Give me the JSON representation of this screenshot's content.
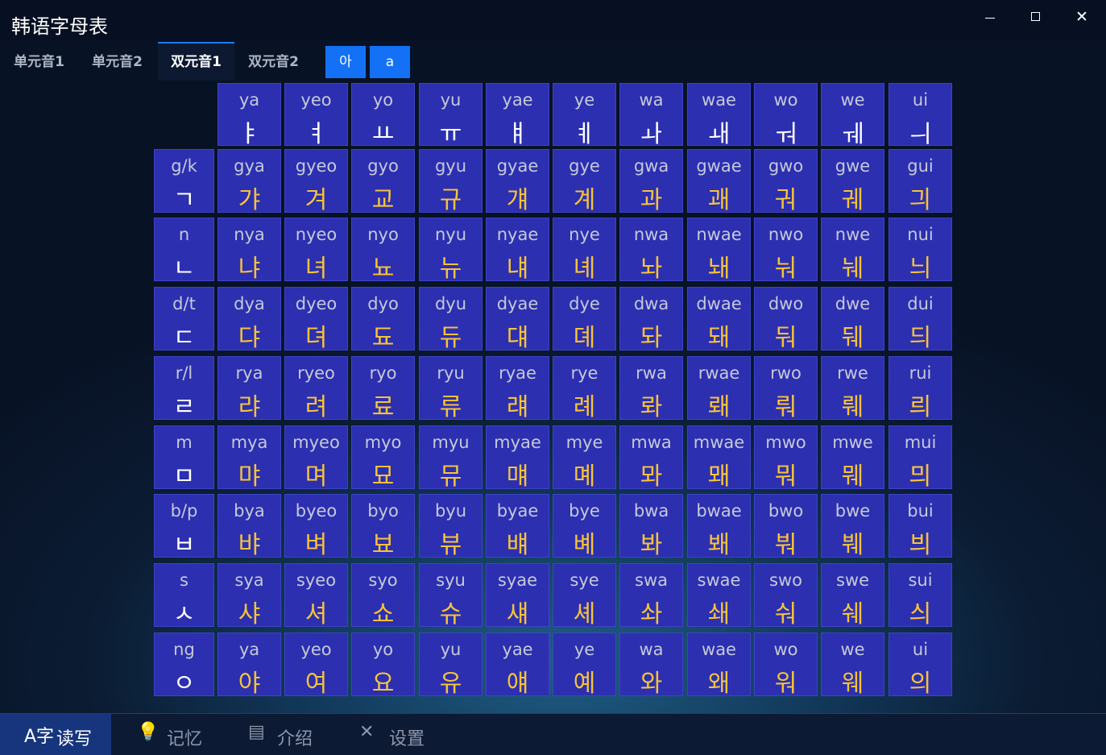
{
  "app": {
    "title": "韩语字母表"
  },
  "tabs": [
    {
      "label": "单元音1"
    },
    {
      "label": "单元音2"
    },
    {
      "label": "双元音1",
      "active": true
    },
    {
      "label": "双元音2"
    }
  ],
  "toggles": [
    {
      "label": "아",
      "active": true
    },
    {
      "label": "a",
      "active": true
    }
  ],
  "vowels": [
    {
      "rom": "ya",
      "kor": "ㅑ"
    },
    {
      "rom": "yeo",
      "kor": "ㅕ"
    },
    {
      "rom": "yo",
      "kor": "ㅛ"
    },
    {
      "rom": "yu",
      "kor": "ㅠ"
    },
    {
      "rom": "yae",
      "kor": "ㅒ"
    },
    {
      "rom": "ye",
      "kor": "ㅖ"
    },
    {
      "rom": "wa",
      "kor": "ㅘ"
    },
    {
      "rom": "wae",
      "kor": "ㅙ"
    },
    {
      "rom": "wo",
      "kor": "ㅝ"
    },
    {
      "rom": "we",
      "kor": "ㅞ"
    },
    {
      "rom": "ui",
      "kor": "ㅢ"
    }
  ],
  "rows": [
    {
      "cons": {
        "rom": "g/k",
        "kor": "ㄱ"
      },
      "cells": [
        {
          "rom": "gya",
          "kor": "갸"
        },
        {
          "rom": "gyeo",
          "kor": "겨"
        },
        {
          "rom": "gyo",
          "kor": "교"
        },
        {
          "rom": "gyu",
          "kor": "규"
        },
        {
          "rom": "gyae",
          "kor": "걔"
        },
        {
          "rom": "gye",
          "kor": "계"
        },
        {
          "rom": "gwa",
          "kor": "과"
        },
        {
          "rom": "gwae",
          "kor": "괘"
        },
        {
          "rom": "gwo",
          "kor": "궈"
        },
        {
          "rom": "gwe",
          "kor": "궤"
        },
        {
          "rom": "gui",
          "kor": "긔"
        }
      ]
    },
    {
      "cons": {
        "rom": "n",
        "kor": "ㄴ"
      },
      "cells": [
        {
          "rom": "nya",
          "kor": "냐"
        },
        {
          "rom": "nyeo",
          "kor": "녀"
        },
        {
          "rom": "nyo",
          "kor": "뇨"
        },
        {
          "rom": "nyu",
          "kor": "뉴"
        },
        {
          "rom": "nyae",
          "kor": "냬"
        },
        {
          "rom": "nye",
          "kor": "녜"
        },
        {
          "rom": "nwa",
          "kor": "놔"
        },
        {
          "rom": "nwae",
          "kor": "놰"
        },
        {
          "rom": "nwo",
          "kor": "눠"
        },
        {
          "rom": "nwe",
          "kor": "눼"
        },
        {
          "rom": "nui",
          "kor": "늬"
        }
      ]
    },
    {
      "cons": {
        "rom": "d/t",
        "kor": "ㄷ"
      },
      "cells": [
        {
          "rom": "dya",
          "kor": "댜"
        },
        {
          "rom": "dyeo",
          "kor": "뎌"
        },
        {
          "rom": "dyo",
          "kor": "됴"
        },
        {
          "rom": "dyu",
          "kor": "듀"
        },
        {
          "rom": "dyae",
          "kor": "댸"
        },
        {
          "rom": "dye",
          "kor": "뎨"
        },
        {
          "rom": "dwa",
          "kor": "돠"
        },
        {
          "rom": "dwae",
          "kor": "돼"
        },
        {
          "rom": "dwo",
          "kor": "둬"
        },
        {
          "rom": "dwe",
          "kor": "뒈"
        },
        {
          "rom": "dui",
          "kor": "듸"
        }
      ]
    },
    {
      "cons": {
        "rom": "r/l",
        "kor": "ㄹ"
      },
      "cells": [
        {
          "rom": "rya",
          "kor": "랴"
        },
        {
          "rom": "ryeo",
          "kor": "려"
        },
        {
          "rom": "ryo",
          "kor": "료"
        },
        {
          "rom": "ryu",
          "kor": "류"
        },
        {
          "rom": "ryae",
          "kor": "럐"
        },
        {
          "rom": "rye",
          "kor": "례"
        },
        {
          "rom": "rwa",
          "kor": "롸"
        },
        {
          "rom": "rwae",
          "kor": "뢔"
        },
        {
          "rom": "rwo",
          "kor": "뤄"
        },
        {
          "rom": "rwe",
          "kor": "뤠"
        },
        {
          "rom": "rui",
          "kor": "릐"
        }
      ]
    },
    {
      "cons": {
        "rom": "m",
        "kor": "ㅁ"
      },
      "cells": [
        {
          "rom": "mya",
          "kor": "먀"
        },
        {
          "rom": "myeo",
          "kor": "며"
        },
        {
          "rom": "myo",
          "kor": "묘"
        },
        {
          "rom": "myu",
          "kor": "뮤"
        },
        {
          "rom": "myae",
          "kor": "먜"
        },
        {
          "rom": "mye",
          "kor": "몌"
        },
        {
          "rom": "mwa",
          "kor": "뫄"
        },
        {
          "rom": "mwae",
          "kor": "뫠"
        },
        {
          "rom": "mwo",
          "kor": "뭐"
        },
        {
          "rom": "mwe",
          "kor": "뭬"
        },
        {
          "rom": "mui",
          "kor": "믜"
        }
      ]
    },
    {
      "cons": {
        "rom": "b/p",
        "kor": "ㅂ"
      },
      "cells": [
        {
          "rom": "bya",
          "kor": "뱌"
        },
        {
          "rom": "byeo",
          "kor": "벼"
        },
        {
          "rom": "byo",
          "kor": "뵤"
        },
        {
          "rom": "byu",
          "kor": "뷰"
        },
        {
          "rom": "byae",
          "kor": "뱨"
        },
        {
          "rom": "bye",
          "kor": "볘"
        },
        {
          "rom": "bwa",
          "kor": "봐"
        },
        {
          "rom": "bwae",
          "kor": "봬"
        },
        {
          "rom": "bwo",
          "kor": "붜"
        },
        {
          "rom": "bwe",
          "kor": "붸"
        },
        {
          "rom": "bui",
          "kor": "븨"
        }
      ]
    },
    {
      "cons": {
        "rom": "s",
        "kor": "ㅅ"
      },
      "cells": [
        {
          "rom": "sya",
          "kor": "샤"
        },
        {
          "rom": "syeo",
          "kor": "셔"
        },
        {
          "rom": "syo",
          "kor": "쇼"
        },
        {
          "rom": "syu",
          "kor": "슈"
        },
        {
          "rom": "syae",
          "kor": "섀"
        },
        {
          "rom": "sye",
          "kor": "셰"
        },
        {
          "rom": "swa",
          "kor": "솨"
        },
        {
          "rom": "swae",
          "kor": "쇄"
        },
        {
          "rom": "swo",
          "kor": "숴"
        },
        {
          "rom": "swe",
          "kor": "쉐"
        },
        {
          "rom": "sui",
          "kor": "싀"
        }
      ]
    },
    {
      "cons": {
        "rom": "ng",
        "kor": "ㅇ"
      },
      "cells": [
        {
          "rom": "ya",
          "kor": "야"
        },
        {
          "rom": "yeo",
          "kor": "여"
        },
        {
          "rom": "yo",
          "kor": "요"
        },
        {
          "rom": "yu",
          "kor": "유"
        },
        {
          "rom": "yae",
          "kor": "얘"
        },
        {
          "rom": "ye",
          "kor": "예"
        },
        {
          "rom": "wa",
          "kor": "와"
        },
        {
          "rom": "wae",
          "kor": "왜"
        },
        {
          "rom": "wo",
          "kor": "워"
        },
        {
          "rom": "we",
          "kor": "웨"
        },
        {
          "rom": "ui",
          "kor": "의"
        }
      ]
    }
  ],
  "nav": [
    {
      "icon": "A字",
      "label": "读写",
      "active": true
    },
    {
      "icon": "💡",
      "label": "记忆"
    },
    {
      "icon": "▤",
      "label": "介绍"
    },
    {
      "icon": "✕",
      "label": "设置"
    }
  ]
}
